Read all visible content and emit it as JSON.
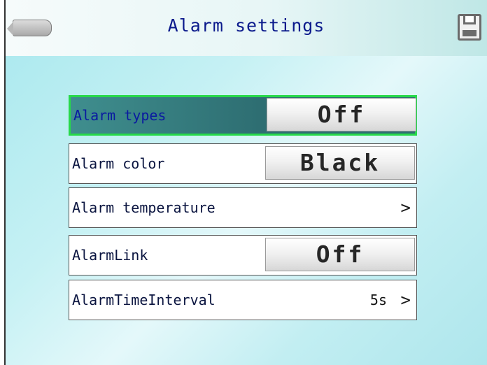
{
  "header": {
    "title": "Alarm settings",
    "back_icon": "back-arrow-icon",
    "save_icon": "save-icon"
  },
  "settings": [
    {
      "label": "Alarm types",
      "value": "Off",
      "kind": "toggle",
      "selected": true
    },
    {
      "label": "Alarm color",
      "value": "Black",
      "kind": "toggle",
      "selected": false
    },
    {
      "label": "Alarm temperature",
      "kind": "submenu",
      "chevron": ">"
    },
    {
      "label": "AlarmLink",
      "value": "Off",
      "kind": "toggle",
      "selected": false
    },
    {
      "label": "AlarmTimeInterval",
      "value": "5s",
      "kind": "submenu",
      "chevron": ">"
    }
  ],
  "colors": {
    "accent_selected_border": "#27d94a",
    "title_text": "#0b1a8c",
    "background": "#c6f1f4"
  }
}
